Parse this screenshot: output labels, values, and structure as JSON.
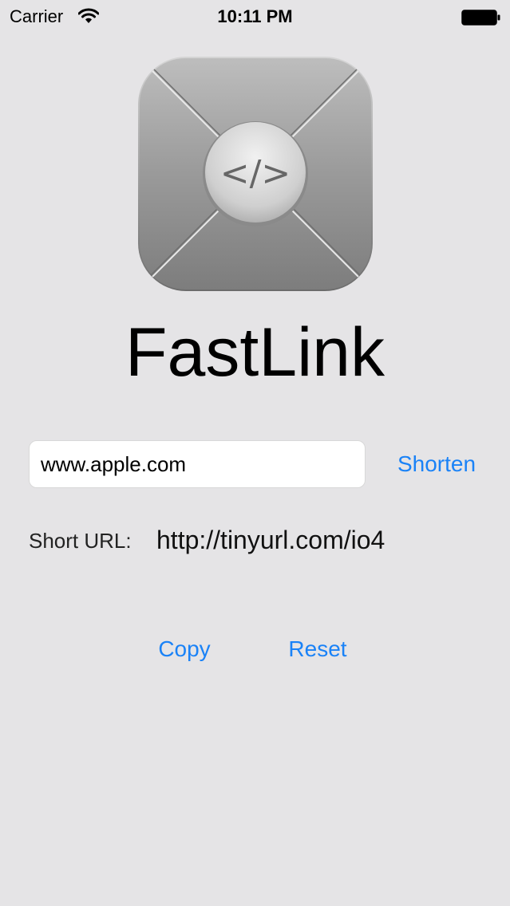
{
  "status_bar": {
    "carrier": "Carrier",
    "time": "10:11 PM"
  },
  "app": {
    "title": "FastLink",
    "icon_glyph": "</>"
  },
  "form": {
    "url_value": "www.apple.com",
    "shorten_label": "Shorten",
    "short_url_label": "Short URL:",
    "short_url_value": "http://tinyurl.com/io4",
    "copy_label": "Copy",
    "reset_label": "Reset"
  },
  "colors": {
    "background": "#e5e4e6",
    "accent": "#1a82f7"
  },
  "icons": {
    "wifi": "wifi-icon",
    "battery": "battery-icon",
    "app": "app-logo-icon"
  }
}
